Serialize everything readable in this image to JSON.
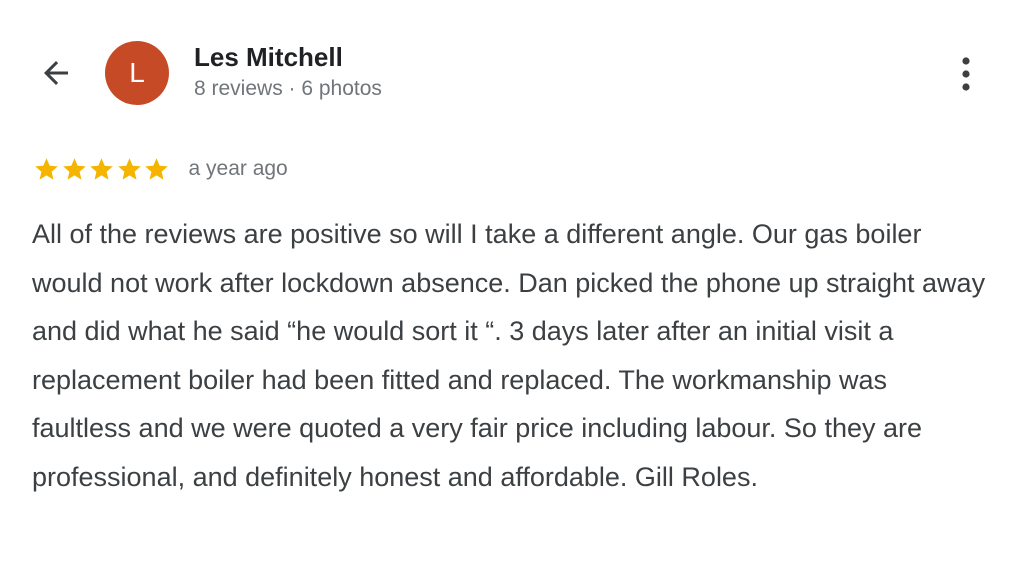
{
  "reviewer": {
    "avatar_initial": "L",
    "avatar_color": "#c74a27",
    "name": "Les Mitchell",
    "meta": "8 reviews · 6 photos"
  },
  "review": {
    "rating": 5,
    "rating_max": 5,
    "star_color": "#f4b400",
    "time": "a year ago",
    "text": "All of the reviews are positive so will I take a different angle. Our gas boiler would not work after lockdown absence. Dan picked the phone up straight away and did what he said “he would sort it “. 3 days later after an initial visit a replacement boiler had been fitted and replaced. The workmanship was faultless and we were quoted a very fair price including labour. So they are professional, and definitely honest and affordable. Gill Roles."
  },
  "icons": {
    "back": "arrow-back-icon",
    "more": "more-vert-icon",
    "star": "star-icon"
  }
}
